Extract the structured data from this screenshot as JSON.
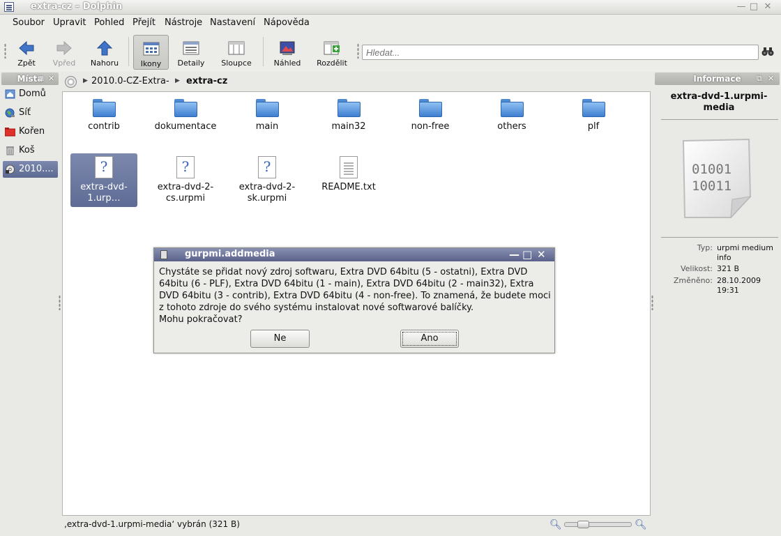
{
  "window": {
    "title": "extra-cz – Dolphin",
    "min": "—",
    "max": "□",
    "close": "✕"
  },
  "menu": [
    {
      "label": "Soubor"
    },
    {
      "label": "Upravit"
    },
    {
      "label": "Pohled"
    },
    {
      "label": "Přejít"
    },
    {
      "label": "Nástroje"
    },
    {
      "label": "Nastavení"
    },
    {
      "label": "Nápověda"
    }
  ],
  "toolbar": {
    "back": "Zpět",
    "forward": "Vpřed",
    "up": "Nahoru",
    "icons": "Ikony",
    "details": "Detaily",
    "columns": "Sloupce",
    "preview": "Náhled",
    "split": "Rozdělit",
    "search_placeholder": "Hledat..."
  },
  "places": {
    "title": "Místa",
    "items": [
      {
        "label": "Domů"
      },
      {
        "label": "Síť"
      },
      {
        "label": "Kořen"
      },
      {
        "label": "Koš"
      },
      {
        "label": "2010...."
      }
    ]
  },
  "breadcrumb": {
    "segment1": "2010.0-CZ-Extra-",
    "segment2": "extra-cz"
  },
  "files": {
    "folders": [
      "contrib",
      "dokumentace",
      "main",
      "main32",
      "non-free",
      "others",
      "plf"
    ],
    "documents": [
      {
        "label": "extra-dvd-1.urp…",
        "selected": true
      },
      {
        "label": "extra-dvd-2-cs.urpmi"
      },
      {
        "label": "extra-dvd-2-sk.urpmi"
      },
      {
        "label": "README.txt"
      }
    ]
  },
  "status": {
    "text": "‚extra-dvd-1.urpmi-media‘ vybrán (321 B)"
  },
  "info": {
    "title": "Informace",
    "filename": "extra-dvd-1.urpmi-media",
    "binary_top": "01001",
    "binary_bottom": "10011",
    "type_key": "Typ:",
    "type_val": "urpmi medium info",
    "size_key": "Velikost:",
    "size_val": "321 B",
    "modified_key": "Změněno:",
    "modified_val": "28.10.2009 19:31"
  },
  "dialog": {
    "title": "gurpmi.addmedia",
    "message": "Chystáte se přidat nový zdroj softwaru, Extra DVD 64bitu (5 - ostatni), Extra DVD 64bitu (6 - PLF), Extra DVD 64bitu (1 - main), Extra DVD 64bitu (2 - main32), Extra DVD 64bitu (3 - contrib), Extra DVD 64bitu (4 - non-free). To znamená, že budete moci z tohoto zdroje do svého systému instalovat nové softwarové balíčky.",
    "question": "Mohu pokračovat?",
    "no": "Ne",
    "yes": "Ano"
  }
}
